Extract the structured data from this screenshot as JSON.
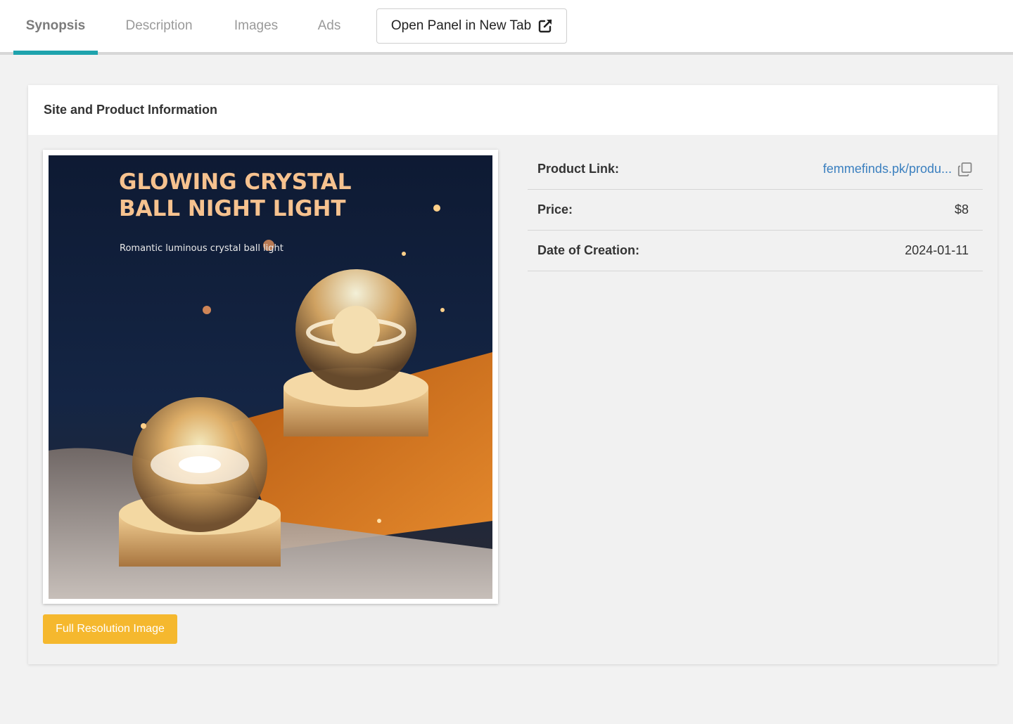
{
  "tabs": [
    {
      "label": "Synopsis",
      "active": true
    },
    {
      "label": "Description",
      "active": false
    },
    {
      "label": "Images",
      "active": false
    },
    {
      "label": "Ads",
      "active": false
    }
  ],
  "open_panel": {
    "label": "Open Panel in New Tab",
    "icon": "external-link-icon"
  },
  "card": {
    "title": "Site and Product Information",
    "image": {
      "headline_line1": "GLOWING CRYSTAL",
      "headline_line2": "BALL NIGHT LIGHT",
      "subtitle": "Romantic luminous crystal ball light"
    },
    "full_res_label": "Full Resolution Image"
  },
  "info": {
    "product_link": {
      "label": "Product Link:",
      "value": "femmefinds.pk/produ...",
      "icon": "copy-icon"
    },
    "price": {
      "label": "Price:",
      "value": "$8"
    },
    "date": {
      "label": "Date of Creation:",
      "value": "2024-01-11"
    }
  },
  "colors": {
    "accent": "#1fa3ad",
    "button": "#f5b82e",
    "link": "#3a7fbf"
  }
}
